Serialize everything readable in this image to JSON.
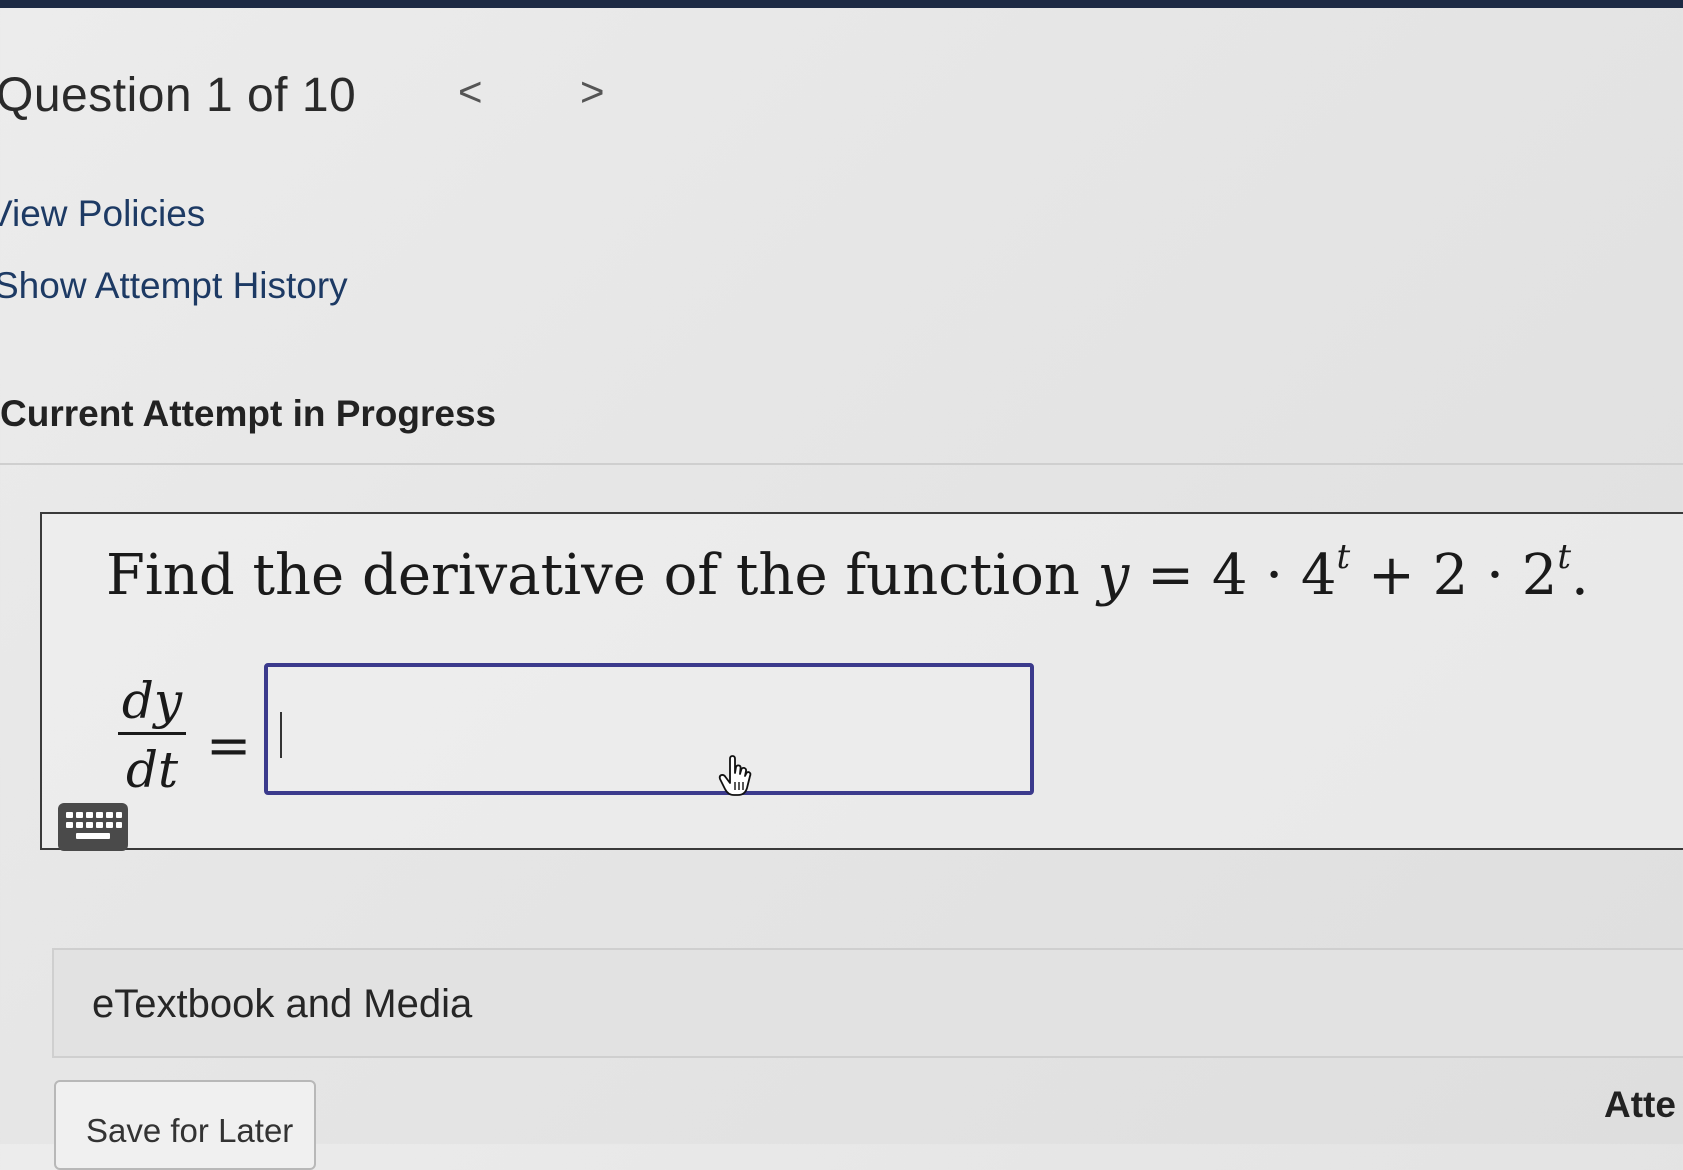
{
  "header": {
    "question_label": "Question 1 of 10",
    "prev_symbol": "<",
    "next_symbol": ">"
  },
  "links": {
    "view_policies": "View Policies",
    "show_attempt_history": "Show Attempt History"
  },
  "attempt": {
    "heading": "Current Attempt in Progress"
  },
  "question": {
    "prompt_text": "Find the derivative of the function ",
    "fn_y": "y",
    "fn_eq": " = 4 · 4",
    "fn_exp1": "t",
    "fn_mid": " + 2 · 2",
    "fn_exp2": "t",
    "fn_end": ".",
    "deriv_num": "dy",
    "deriv_den": "dt",
    "equals": "=",
    "answer_value": ""
  },
  "icons": {
    "keyboard": "keyboard-icon",
    "cursor": "hand-pointer-icon"
  },
  "etextbook": {
    "label": "eTextbook and Media"
  },
  "footer": {
    "save_label": "Save for Later",
    "attempts_label": "Atte"
  }
}
